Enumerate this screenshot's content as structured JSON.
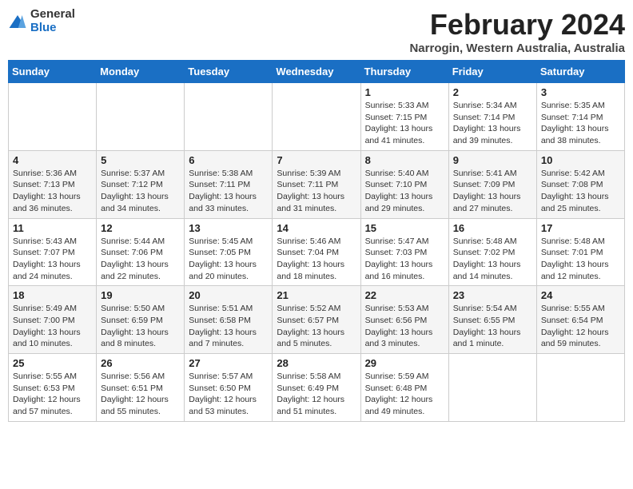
{
  "header": {
    "logo_general": "General",
    "logo_blue": "Blue",
    "month_year": "February 2024",
    "location": "Narrogin, Western Australia, Australia"
  },
  "weekdays": [
    "Sunday",
    "Monday",
    "Tuesday",
    "Wednesday",
    "Thursday",
    "Friday",
    "Saturday"
  ],
  "weeks": [
    [
      {
        "day": "",
        "detail": ""
      },
      {
        "day": "",
        "detail": ""
      },
      {
        "day": "",
        "detail": ""
      },
      {
        "day": "",
        "detail": ""
      },
      {
        "day": "1",
        "detail": "Sunrise: 5:33 AM\nSunset: 7:15 PM\nDaylight: 13 hours\nand 41 minutes."
      },
      {
        "day": "2",
        "detail": "Sunrise: 5:34 AM\nSunset: 7:14 PM\nDaylight: 13 hours\nand 39 minutes."
      },
      {
        "day": "3",
        "detail": "Sunrise: 5:35 AM\nSunset: 7:14 PM\nDaylight: 13 hours\nand 38 minutes."
      }
    ],
    [
      {
        "day": "4",
        "detail": "Sunrise: 5:36 AM\nSunset: 7:13 PM\nDaylight: 13 hours\nand 36 minutes."
      },
      {
        "day": "5",
        "detail": "Sunrise: 5:37 AM\nSunset: 7:12 PM\nDaylight: 13 hours\nand 34 minutes."
      },
      {
        "day": "6",
        "detail": "Sunrise: 5:38 AM\nSunset: 7:11 PM\nDaylight: 13 hours\nand 33 minutes."
      },
      {
        "day": "7",
        "detail": "Sunrise: 5:39 AM\nSunset: 7:11 PM\nDaylight: 13 hours\nand 31 minutes."
      },
      {
        "day": "8",
        "detail": "Sunrise: 5:40 AM\nSunset: 7:10 PM\nDaylight: 13 hours\nand 29 minutes."
      },
      {
        "day": "9",
        "detail": "Sunrise: 5:41 AM\nSunset: 7:09 PM\nDaylight: 13 hours\nand 27 minutes."
      },
      {
        "day": "10",
        "detail": "Sunrise: 5:42 AM\nSunset: 7:08 PM\nDaylight: 13 hours\nand 25 minutes."
      }
    ],
    [
      {
        "day": "11",
        "detail": "Sunrise: 5:43 AM\nSunset: 7:07 PM\nDaylight: 13 hours\nand 24 minutes."
      },
      {
        "day": "12",
        "detail": "Sunrise: 5:44 AM\nSunset: 7:06 PM\nDaylight: 13 hours\nand 22 minutes."
      },
      {
        "day": "13",
        "detail": "Sunrise: 5:45 AM\nSunset: 7:05 PM\nDaylight: 13 hours\nand 20 minutes."
      },
      {
        "day": "14",
        "detail": "Sunrise: 5:46 AM\nSunset: 7:04 PM\nDaylight: 13 hours\nand 18 minutes."
      },
      {
        "day": "15",
        "detail": "Sunrise: 5:47 AM\nSunset: 7:03 PM\nDaylight: 13 hours\nand 16 minutes."
      },
      {
        "day": "16",
        "detail": "Sunrise: 5:48 AM\nSunset: 7:02 PM\nDaylight: 13 hours\nand 14 minutes."
      },
      {
        "day": "17",
        "detail": "Sunrise: 5:48 AM\nSunset: 7:01 PM\nDaylight: 13 hours\nand 12 minutes."
      }
    ],
    [
      {
        "day": "18",
        "detail": "Sunrise: 5:49 AM\nSunset: 7:00 PM\nDaylight: 13 hours\nand 10 minutes."
      },
      {
        "day": "19",
        "detail": "Sunrise: 5:50 AM\nSunset: 6:59 PM\nDaylight: 13 hours\nand 8 minutes."
      },
      {
        "day": "20",
        "detail": "Sunrise: 5:51 AM\nSunset: 6:58 PM\nDaylight: 13 hours\nand 7 minutes."
      },
      {
        "day": "21",
        "detail": "Sunrise: 5:52 AM\nSunset: 6:57 PM\nDaylight: 13 hours\nand 5 minutes."
      },
      {
        "day": "22",
        "detail": "Sunrise: 5:53 AM\nSunset: 6:56 PM\nDaylight: 13 hours\nand 3 minutes."
      },
      {
        "day": "23",
        "detail": "Sunrise: 5:54 AM\nSunset: 6:55 PM\nDaylight: 13 hours\nand 1 minute."
      },
      {
        "day": "24",
        "detail": "Sunrise: 5:55 AM\nSunset: 6:54 PM\nDaylight: 12 hours\nand 59 minutes."
      }
    ],
    [
      {
        "day": "25",
        "detail": "Sunrise: 5:55 AM\nSunset: 6:53 PM\nDaylight: 12 hours\nand 57 minutes."
      },
      {
        "day": "26",
        "detail": "Sunrise: 5:56 AM\nSunset: 6:51 PM\nDaylight: 12 hours\nand 55 minutes."
      },
      {
        "day": "27",
        "detail": "Sunrise: 5:57 AM\nSunset: 6:50 PM\nDaylight: 12 hours\nand 53 minutes."
      },
      {
        "day": "28",
        "detail": "Sunrise: 5:58 AM\nSunset: 6:49 PM\nDaylight: 12 hours\nand 51 minutes."
      },
      {
        "day": "29",
        "detail": "Sunrise: 5:59 AM\nSunset: 6:48 PM\nDaylight: 12 hours\nand 49 minutes."
      },
      {
        "day": "",
        "detail": ""
      },
      {
        "day": "",
        "detail": ""
      }
    ]
  ]
}
